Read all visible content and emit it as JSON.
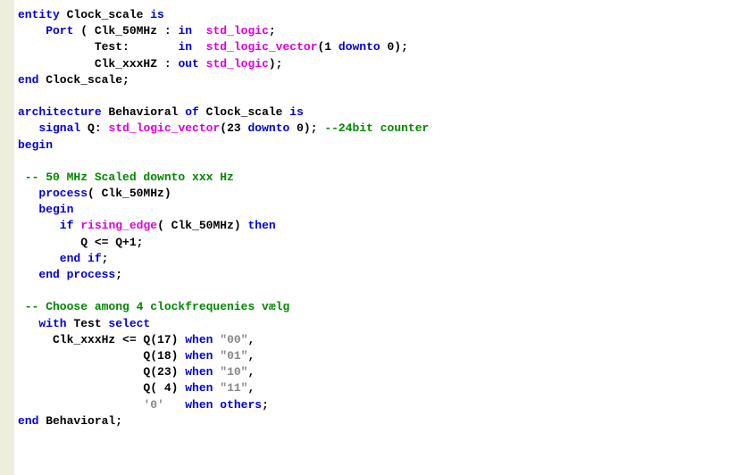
{
  "code": {
    "line1_kw1": "entity",
    "line1_name": " Clock_scale ",
    "line1_kw2": "is",
    "line2_kw1": "    Port",
    "line2_txt1": " ( Clk_50MHz : ",
    "line2_kw2": "in",
    "line2_txt2": "  ",
    "line2_type": "std_logic",
    "line2_txt3": ";",
    "line3_txt1": "           Test:       ",
    "line3_kw1": "in",
    "line3_txt2": "  ",
    "line3_type": "std_logic_vector",
    "line3_txt3": "(1 ",
    "line3_kw2": "downto",
    "line3_txt4": " 0);",
    "line4_txt1": "           Clk_xxxHZ : ",
    "line4_kw1": "out",
    "line4_txt2": " ",
    "line4_type": "std_logic",
    "line4_txt3": ");",
    "line5_kw1": "end",
    "line5_txt": " Clock_scale;",
    "line7_kw1": "architecture",
    "line7_txt1": " Behavioral ",
    "line7_kw2": "of",
    "line7_txt2": " Clock_scale ",
    "line7_kw3": "is",
    "line8_kw1": "   signal",
    "line8_txt1": " Q: ",
    "line8_type": "std_logic_vector",
    "line8_txt2": "(23 ",
    "line8_kw2": "downto",
    "line8_txt3": " 0); ",
    "line8_comment": "--24bit counter",
    "line9_kw": "begin",
    "line11_comment": " -- 50 MHz Scaled downto xxx Hz",
    "line12_kw": "   process",
    "line12_txt": "( Clk_50MHz)",
    "line13_kw": "   begin",
    "line14_kw1": "      if",
    "line14_txt1": " ",
    "line14_type": "rising_edge",
    "line14_txt2": "( Clk_50MHz) ",
    "line14_kw2": "then",
    "line15_txt": "         Q <= Q+1;",
    "line16_kw": "      end if",
    "line16_txt": ";",
    "line17_kw": "   end process",
    "line17_txt": ";",
    "line19_comment": " -- Choose among 4 clockfrequenies vælg",
    "line20_kw1": "   with",
    "line20_txt": " Test ",
    "line20_kw2": "select",
    "line21_txt1": "     Clk_xxxHz <= Q(17) ",
    "line21_kw": "when",
    "line21_txt2": " ",
    "line21_str": "\"00\"",
    "line21_txt3": ",",
    "line22_txt1": "                  Q(18) ",
    "line22_kw": "when",
    "line22_txt2": " ",
    "line22_str": "\"01\"",
    "line22_txt3": ",",
    "line23_txt1": "                  Q(23) ",
    "line23_kw": "when",
    "line23_txt2": " ",
    "line23_str": "\"10\"",
    "line23_txt3": ",",
    "line24_txt1": "                  Q( 4) ",
    "line24_kw": "when",
    "line24_txt2": " ",
    "line24_str": "\"11\"",
    "line24_txt3": ",",
    "line25_txt1": "                  ",
    "line25_str": "'0'",
    "line25_txt2": "   ",
    "line25_kw": "when",
    "line25_txt3": " ",
    "line25_kw2": "others",
    "line25_txt4": ";",
    "line26_kw": "end",
    "line26_txt": " Behavioral;"
  }
}
